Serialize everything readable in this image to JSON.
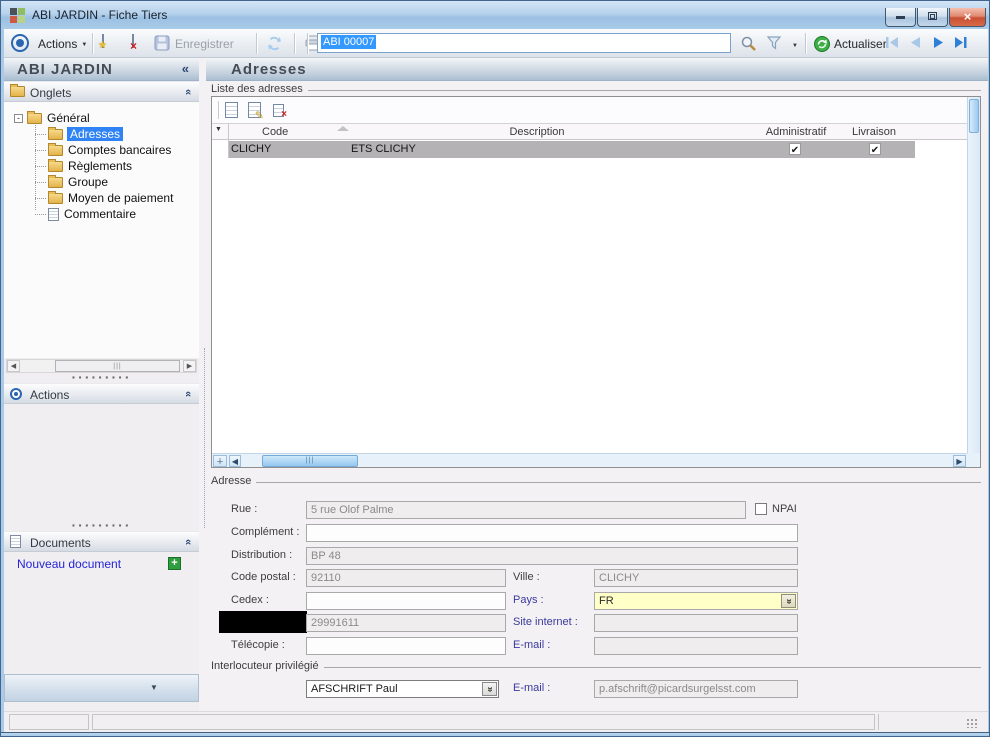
{
  "window": {
    "title": "ABI JARDIN - Fiche Tiers"
  },
  "toolbar": {
    "actions": "Actions",
    "save": "Enregistrer",
    "record_id": "ABI 00007",
    "refresh": "Actualiser"
  },
  "sidebar": {
    "title": "ABI JARDIN",
    "onglets": "Onglets",
    "actions": "Actions",
    "documents": "Documents",
    "new_document": "Nouveau document",
    "tree_root": "Général",
    "tree_items": [
      "Adresses",
      "Comptes bancaires",
      "Règlements",
      "Groupe",
      "Moyen de paiement",
      "Commentaire"
    ]
  },
  "main": {
    "title": "Adresses",
    "list_label": "Liste des adresses",
    "table": {
      "col_code": "Code",
      "col_description": "Description",
      "col_administratif": "Administratif",
      "col_livraison": "Livraison",
      "rows": [
        {
          "code": "CLICHY",
          "description": "ETS CLICHY",
          "administratif": true,
          "livraison": true
        }
      ]
    },
    "address": {
      "label": "Adresse",
      "rue_label": "Rue :",
      "rue_value": "5 rue Olof Palme",
      "npai_label": "NPAI",
      "npai_checked": false,
      "complement_label": "Complément :",
      "complement_value": "",
      "distribution_label": "Distribution :",
      "distribution_value": "BP 48",
      "code_postal_label": "Code postal :",
      "code_postal_value": "92110",
      "ville_label": "Ville :",
      "ville_value": "CLICHY",
      "cedex_label": "Cedex :",
      "cedex_value": "",
      "pays_label": "Pays :",
      "pays_value": "FR",
      "telephone_value": "29991611",
      "site_label": "Site internet :",
      "site_value": "",
      "telecopie_label": "Télécopie :",
      "telecopie_value": "",
      "email_label": "E-mail :",
      "email_value": ""
    },
    "contact": {
      "label": "Interlocuteur privilégié",
      "name": "AFSCHRIFT Paul",
      "email_label": "E-mail :",
      "email_value": "p.afschrift@picardsurgelsst.com"
    }
  },
  "colors": {
    "selection_blue": "#3399ff",
    "tree_selection": "#2f83f5",
    "combo_yellow": "#ffffc8"
  }
}
